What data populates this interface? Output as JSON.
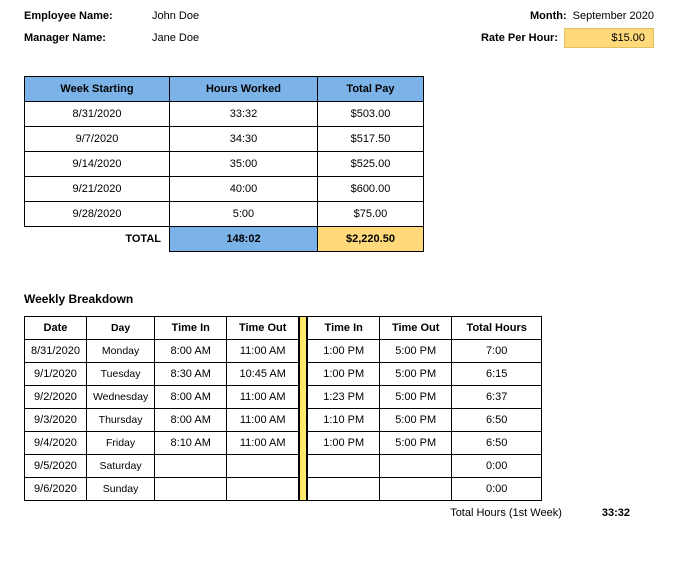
{
  "header": {
    "emp_label": "Employee Name:",
    "emp_value": "John Doe",
    "mgr_label": "Manager Name:",
    "mgr_value": "Jane Doe",
    "month_label": "Month:",
    "month_value": "September 2020",
    "rate_label": "Rate Per Hour:",
    "rate_value": "$15.00"
  },
  "summary": {
    "cols": {
      "c1": "Week Starting",
      "c2": "Hours Worked",
      "c3": "Total Pay"
    },
    "rows": [
      {
        "week": "8/31/2020",
        "hours": "33:32",
        "pay": "$503.00"
      },
      {
        "week": "9/7/2020",
        "hours": "34:30",
        "pay": "$517.50"
      },
      {
        "week": "9/14/2020",
        "hours": "35:00",
        "pay": "$525.00"
      },
      {
        "week": "9/21/2020",
        "hours": "40:00",
        "pay": "$600.00"
      },
      {
        "week": "9/28/2020",
        "hours": "5:00",
        "pay": "$75.00"
      }
    ],
    "total_label": "TOTAL",
    "total_hours": "148:02",
    "total_pay": "$2,220.50"
  },
  "breakdown_title": "Weekly Breakdown",
  "breakdown": {
    "cols_a": {
      "date": "Date",
      "day": "Day",
      "tin": "Time In",
      "tout": "Time Out"
    },
    "cols_b": {
      "tin": "Time In",
      "tout": "Time Out",
      "total": "Total Hours"
    },
    "rows": [
      {
        "date": "8/31/2020",
        "day": "Monday",
        "tin1": "8:00 AM",
        "tout1": "11:00 AM",
        "tin2": "1:00 PM",
        "tout2": "5:00 PM",
        "total": "7:00"
      },
      {
        "date": "9/1/2020",
        "day": "Tuesday",
        "tin1": "8:30 AM",
        "tout1": "10:45 AM",
        "tin2": "1:00 PM",
        "tout2": "5:00 PM",
        "total": "6:15"
      },
      {
        "date": "9/2/2020",
        "day": "Wednesday",
        "tin1": "8:00 AM",
        "tout1": "11:00 AM",
        "tin2": "1:23 PM",
        "tout2": "5:00 PM",
        "total": "6:37"
      },
      {
        "date": "9/3/2020",
        "day": "Thursday",
        "tin1": "8:00 AM",
        "tout1": "11:00 AM",
        "tin2": "1:10 PM",
        "tout2": "5:00 PM",
        "total": "6:50"
      },
      {
        "date": "9/4/2020",
        "day": "Friday",
        "tin1": "8:10 AM",
        "tout1": "11:00 AM",
        "tin2": "1:00 PM",
        "tout2": "5:00 PM",
        "total": "6:50"
      },
      {
        "date": "9/5/2020",
        "day": "Saturday",
        "tin1": "",
        "tout1": "",
        "tin2": "",
        "tout2": "",
        "total": "0:00"
      },
      {
        "date": "9/6/2020",
        "day": "Sunday",
        "tin1": "",
        "tout1": "",
        "tin2": "",
        "tout2": "",
        "total": "0:00"
      }
    ],
    "footer_label": "Total Hours (1st Week)",
    "footer_value": "33:32"
  },
  "chart_data": [
    {
      "type": "table",
      "title": "Weekly summary",
      "columns": [
        "Week Starting",
        "Hours Worked",
        "Total Pay"
      ],
      "rows": [
        [
          "8/31/2020",
          "33:32",
          503.0
        ],
        [
          "9/7/2020",
          "34:30",
          517.5
        ],
        [
          "9/14/2020",
          "35:00",
          525.0
        ],
        [
          "9/21/2020",
          "40:00",
          600.0
        ],
        [
          "9/28/2020",
          "5:00",
          75.0
        ]
      ],
      "total": {
        "hours": "148:02",
        "pay": 2220.5
      }
    },
    {
      "type": "table",
      "title": "Weekly Breakdown",
      "columns": [
        "Date",
        "Day",
        "Time In",
        "Time Out",
        "Time In",
        "Time Out",
        "Total Hours"
      ],
      "rows": [
        [
          "8/31/2020",
          "Monday",
          "8:00 AM",
          "11:00 AM",
          "1:00 PM",
          "5:00 PM",
          "7:00"
        ],
        [
          "9/1/2020",
          "Tuesday",
          "8:30 AM",
          "10:45 AM",
          "1:00 PM",
          "5:00 PM",
          "6:15"
        ],
        [
          "9/2/2020",
          "Wednesday",
          "8:00 AM",
          "11:00 AM",
          "1:23 PM",
          "5:00 PM",
          "6:37"
        ],
        [
          "9/3/2020",
          "Thursday",
          "8:00 AM",
          "11:00 AM",
          "1:10 PM",
          "5:00 PM",
          "6:50"
        ],
        [
          "9/4/2020",
          "Friday",
          "8:10 AM",
          "11:00 AM",
          "1:00 PM",
          "5:00 PM",
          "6:50"
        ],
        [
          "9/5/2020",
          "Saturday",
          "",
          "",
          "",
          "",
          "0:00"
        ],
        [
          "9/6/2020",
          "Sunday",
          "",
          "",
          "",
          "",
          "0:00"
        ]
      ],
      "footer": {
        "label": "Total Hours (1st Week)",
        "value": "33:32"
      }
    }
  ]
}
